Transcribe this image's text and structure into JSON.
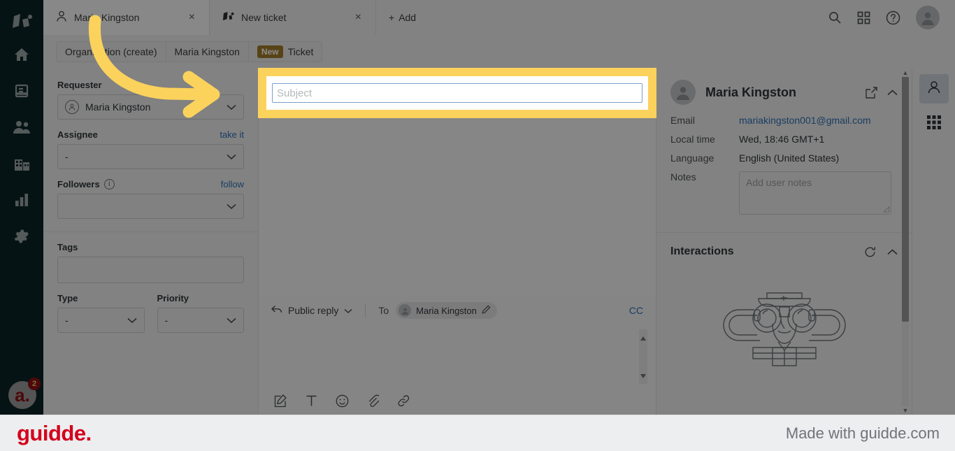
{
  "app": {
    "left_rail": {
      "logo_icon": "zammad-logo-icon",
      "items": [
        {
          "name": "dashboard",
          "icon": "home-icon"
        },
        {
          "name": "overviews",
          "icon": "overviews-icon"
        },
        {
          "name": "customers",
          "icon": "people-icon"
        },
        {
          "name": "organizations",
          "icon": "building-icon"
        },
        {
          "name": "reporting",
          "icon": "bar-chart-icon"
        },
        {
          "name": "settings",
          "icon": "gear-icon"
        }
      ],
      "avatar": {
        "initial": "a.",
        "badge_count": "2"
      }
    },
    "tabs": [
      {
        "label": "Maria Kingston",
        "icon": "person-icon",
        "active": true,
        "close": "×"
      },
      {
        "label": "New ticket",
        "icon": "ticket-logo-icon",
        "active": false,
        "close": "×"
      }
    ],
    "add_tab_label": "Add",
    "add_tab_plus": "+",
    "top_actions": [
      {
        "name": "search-icon"
      },
      {
        "name": "apps-grid-icon"
      },
      {
        "name": "help-icon"
      },
      {
        "name": "user-avatar"
      }
    ],
    "breadcrumb": {
      "items": [
        {
          "label": "Organization (create)"
        },
        {
          "label": "Maria Kingston"
        }
      ],
      "state_badge": "New",
      "state_label": "Ticket"
    }
  },
  "form": {
    "requester": {
      "label": "Requester",
      "value": "Maria Kingston"
    },
    "assignee": {
      "label": "Assignee",
      "action": "take it",
      "value": "-"
    },
    "followers": {
      "label": "Followers",
      "action": "follow",
      "value": ""
    },
    "tags": {
      "label": "Tags",
      "value": ""
    },
    "type": {
      "label": "Type",
      "value": "-"
    },
    "priority": {
      "label": "Priority",
      "value": "-"
    }
  },
  "center": {
    "subject": {
      "value": "",
      "placeholder": "Subject"
    },
    "composer": {
      "reply_type": "Public reply",
      "to_label": "To",
      "recipient": "Maria Kingston",
      "cc_label": "CC",
      "tools": [
        {
          "name": "signature-icon"
        },
        {
          "name": "text-format-icon"
        },
        {
          "name": "emoji-icon"
        },
        {
          "name": "attachment-icon"
        },
        {
          "name": "link-icon"
        }
      ]
    }
  },
  "sidebar": {
    "customer": {
      "title": "Maria Kingston",
      "open_icon": "open-external-icon",
      "collapse_icon": "chevron-up-icon",
      "fields": [
        {
          "key": "Email",
          "value": "mariakingston001@gmail.com",
          "is_link": true
        },
        {
          "key": "Local time",
          "value": "Wed, 18:46 GMT+1",
          "is_link": false
        },
        {
          "key": "Language",
          "value": "English (United States)",
          "is_link": false
        }
      ],
      "notes": {
        "key": "Notes",
        "placeholder": "Add user notes"
      }
    },
    "interactions": {
      "title": "Interactions",
      "refresh_icon": "refresh-icon",
      "collapse_icon": "chevron-up-icon",
      "empty_illustration": "sailor-binoculars-icon"
    },
    "icon_rail": [
      {
        "name": "customer-icon",
        "active": true
      },
      {
        "name": "apps-grid-icon",
        "active": false
      }
    ]
  },
  "footer": {
    "logo": "guidde.",
    "made_with": "Made with guidde.com"
  }
}
